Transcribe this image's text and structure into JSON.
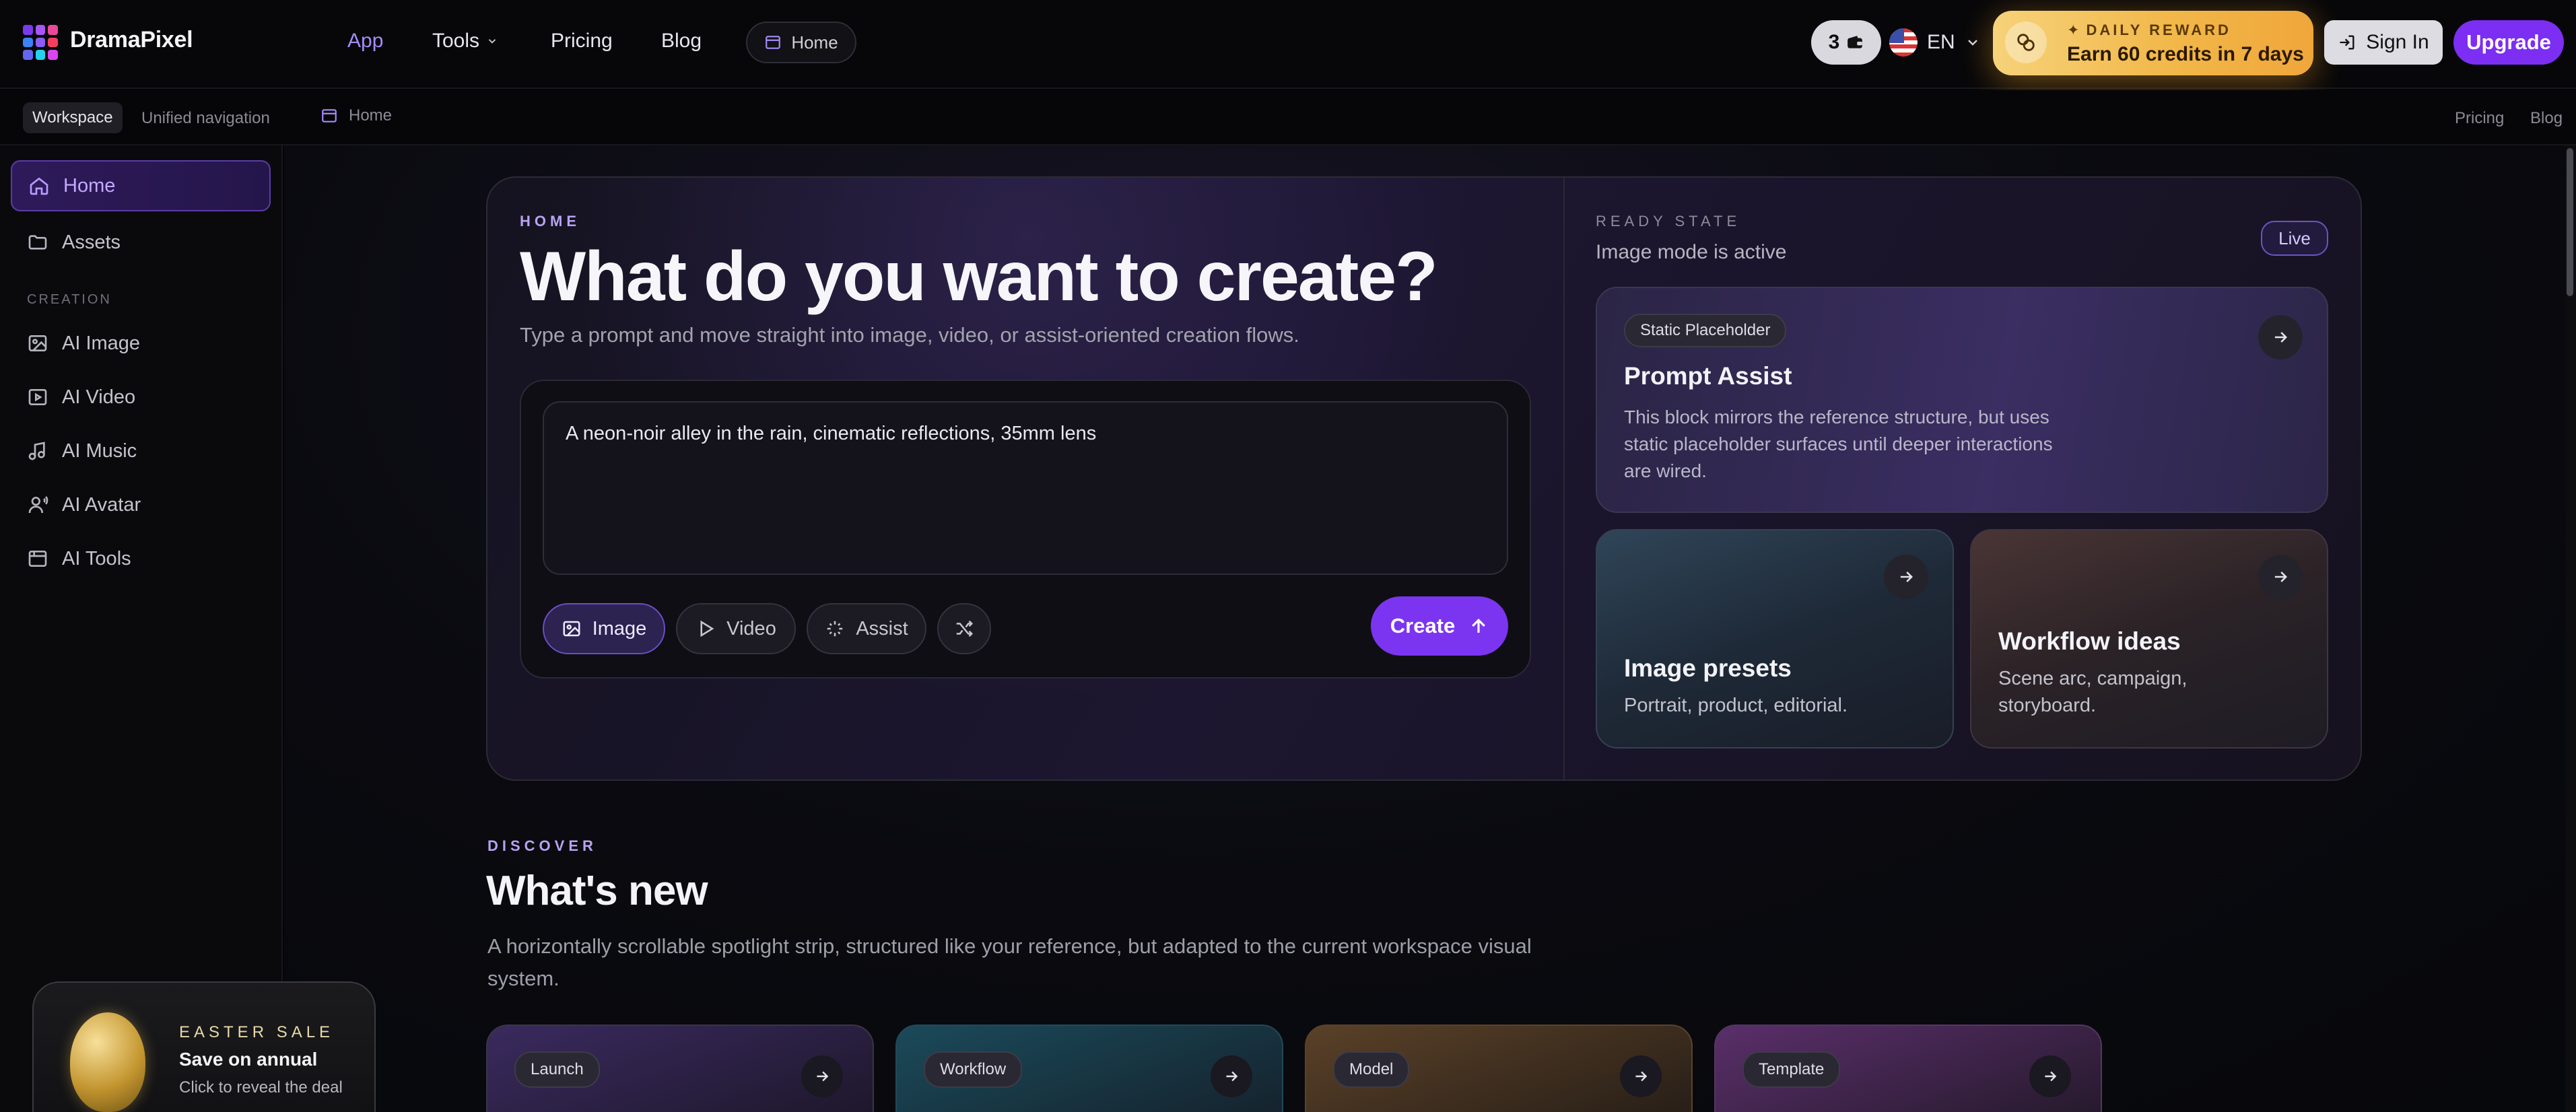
{
  "brand": {
    "name": "DramaPixel",
    "logo_colors": [
      "#7c3aed",
      "#a855f7",
      "#ec4899",
      "#3b82f6",
      "#8b5cf6",
      "#f43f5e",
      "#6366f1",
      "#22d3ee",
      "#d946ef"
    ]
  },
  "topnav": {
    "links": [
      "App",
      "Tools",
      "Pricing",
      "Blog"
    ],
    "home_pill": "Home",
    "credits": "3",
    "language": "EN",
    "reward_kicker": "DAILY REWARD",
    "reward_main": "Earn 60 credits in 7 days",
    "sign_in": "Sign In",
    "upgrade": "Upgrade"
  },
  "subnav": {
    "workspace": "Workspace",
    "unified": "Unified navigation",
    "breadcrumb": "Home",
    "right_links": [
      "Pricing",
      "Blog"
    ]
  },
  "sidebar": {
    "items": [
      {
        "label": "Home",
        "icon": "home-icon"
      },
      {
        "label": "Assets",
        "icon": "folder-icon"
      }
    ],
    "section": "CREATION",
    "creation_items": [
      {
        "label": "AI Image",
        "icon": "image-icon"
      },
      {
        "label": "AI Video",
        "icon": "video-icon"
      },
      {
        "label": "AI Music",
        "icon": "music-icon"
      },
      {
        "label": "AI Avatar",
        "icon": "avatar-icon"
      },
      {
        "label": "AI Tools",
        "icon": "tools-icon"
      }
    ]
  },
  "hero": {
    "kicker": "HOME",
    "title": "What do you want to create?",
    "subtitle": "Type a prompt and move straight into image, video, or assist-oriented creation flows.",
    "prompt_value": "A neon-noir alley in the rain, cinematic reflections, 35mm lens",
    "modes": [
      "Image",
      "Video",
      "Assist"
    ],
    "active_mode": "Image",
    "create": "Create"
  },
  "ready": {
    "kicker": "READY STATE",
    "subtitle": "Image mode is active",
    "badge": "Live",
    "prompt_assist": {
      "chip": "Static Placeholder",
      "title": "Prompt Assist",
      "desc": "This block mirrors the reference structure, but uses static placeholder surfaces until deeper interactions are wired."
    },
    "image_presets": {
      "title": "Image presets",
      "desc": "Portrait, product, editorial."
    },
    "workflow_ideas": {
      "title": "Workflow ideas",
      "desc": "Scene arc, campaign, storyboard."
    }
  },
  "discover": {
    "kicker": "DISCOVER",
    "title": "What's new",
    "desc": "A horizontally scrollable spotlight strip, structured like your reference, but adapted to the current workspace visual system.",
    "cards": [
      "Launch",
      "Workflow",
      "Model",
      "Template"
    ]
  },
  "promo": {
    "kicker": "EASTER SALE",
    "main": "Save on annual",
    "sub": "Click to reveal the deal"
  }
}
